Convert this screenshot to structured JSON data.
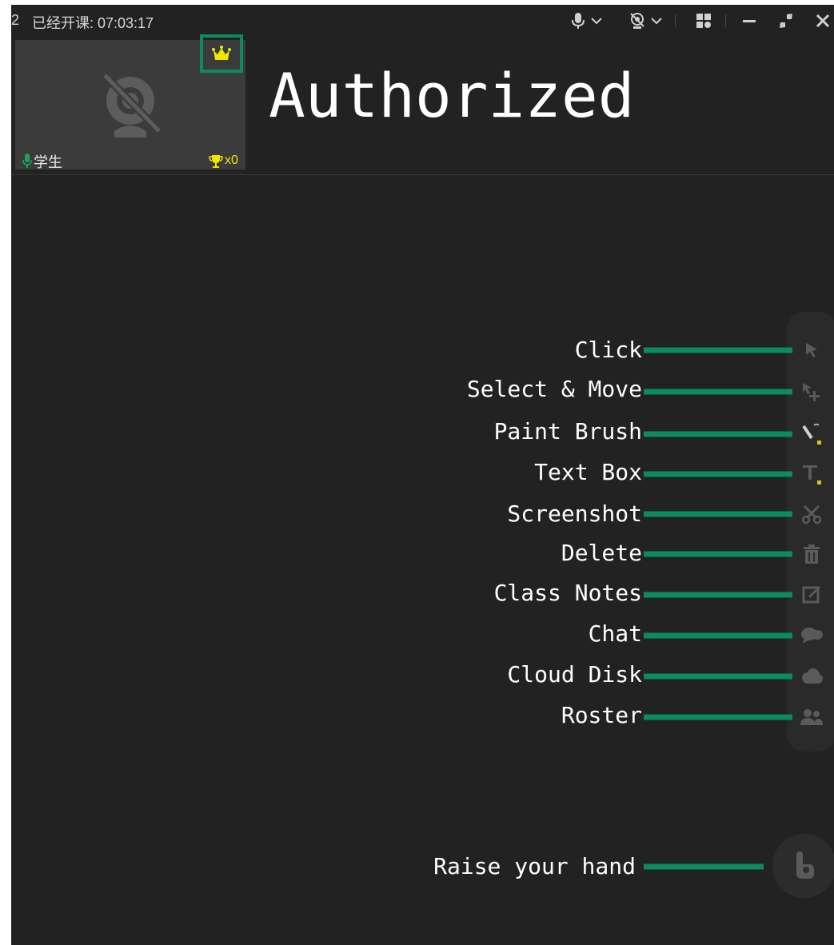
{
  "titlebar": {
    "class_number": "2",
    "class_time": "已经开课: 07:03:17"
  },
  "video_tile": {
    "student_name": "学生",
    "trophy_count": "x0"
  },
  "heading": "Authorized",
  "tools": [
    {
      "label": "Click",
      "icon": "pointer-icon"
    },
    {
      "label": "Select & Move",
      "icon": "select-move-icon"
    },
    {
      "label": "Paint Brush",
      "icon": "paint-brush-icon"
    },
    {
      "label": "Text Box",
      "icon": "text-box-icon"
    },
    {
      "label": "Screenshot",
      "icon": "scissors-icon"
    },
    {
      "label": "Delete",
      "icon": "trash-icon"
    },
    {
      "label": "Class Notes",
      "icon": "edit-note-icon"
    },
    {
      "label": "Chat",
      "icon": "chat-icon"
    },
    {
      "label": "Cloud Disk",
      "icon": "cloud-icon"
    },
    {
      "label": "Roster",
      "icon": "people-icon"
    }
  ],
  "raise_hand": {
    "label": "Raise your hand",
    "icon": "raise-hand-icon"
  },
  "colors": {
    "background": "#222222",
    "annotation_green": "#0a8c5f",
    "crown_yellow": "#f2e600",
    "mic_green": "#1aa260",
    "icon_gray": "#5a5a5a"
  }
}
